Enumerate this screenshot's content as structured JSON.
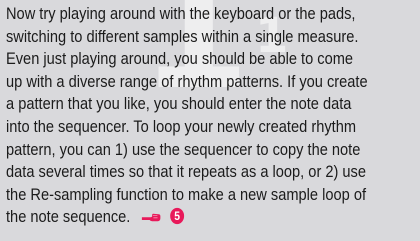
{
  "background_glyphs": [
    "1",
    "1"
  ],
  "paragraph": {
    "lines": [
      "Now try playing around with the keyboard or the pads,",
      "switching to different samples within a single measure.",
      "Even just playing around, you should be able to come",
      "up with a diverse range of rhythm patterns. If you create",
      "a pattern that you like, you should enter the note data",
      "into the sequencer. To loop your newly created rhythm",
      "pattern, you can 1) use the sequencer to copy the note",
      "data several times so that it repeats as a loop, or 2) use",
      "the Re-sampling function to make a new sample loop of",
      "the note sequence."
    ],
    "reference_step": "5",
    "icons": {
      "pointer": "pointing-hand-icon",
      "step": "circled-number-icon"
    }
  },
  "colors": {
    "background": "#d9d9dc",
    "text": "#1b1b1b",
    "pointer_icon": "#e8195a",
    "step_icon": "#e8195a"
  }
}
